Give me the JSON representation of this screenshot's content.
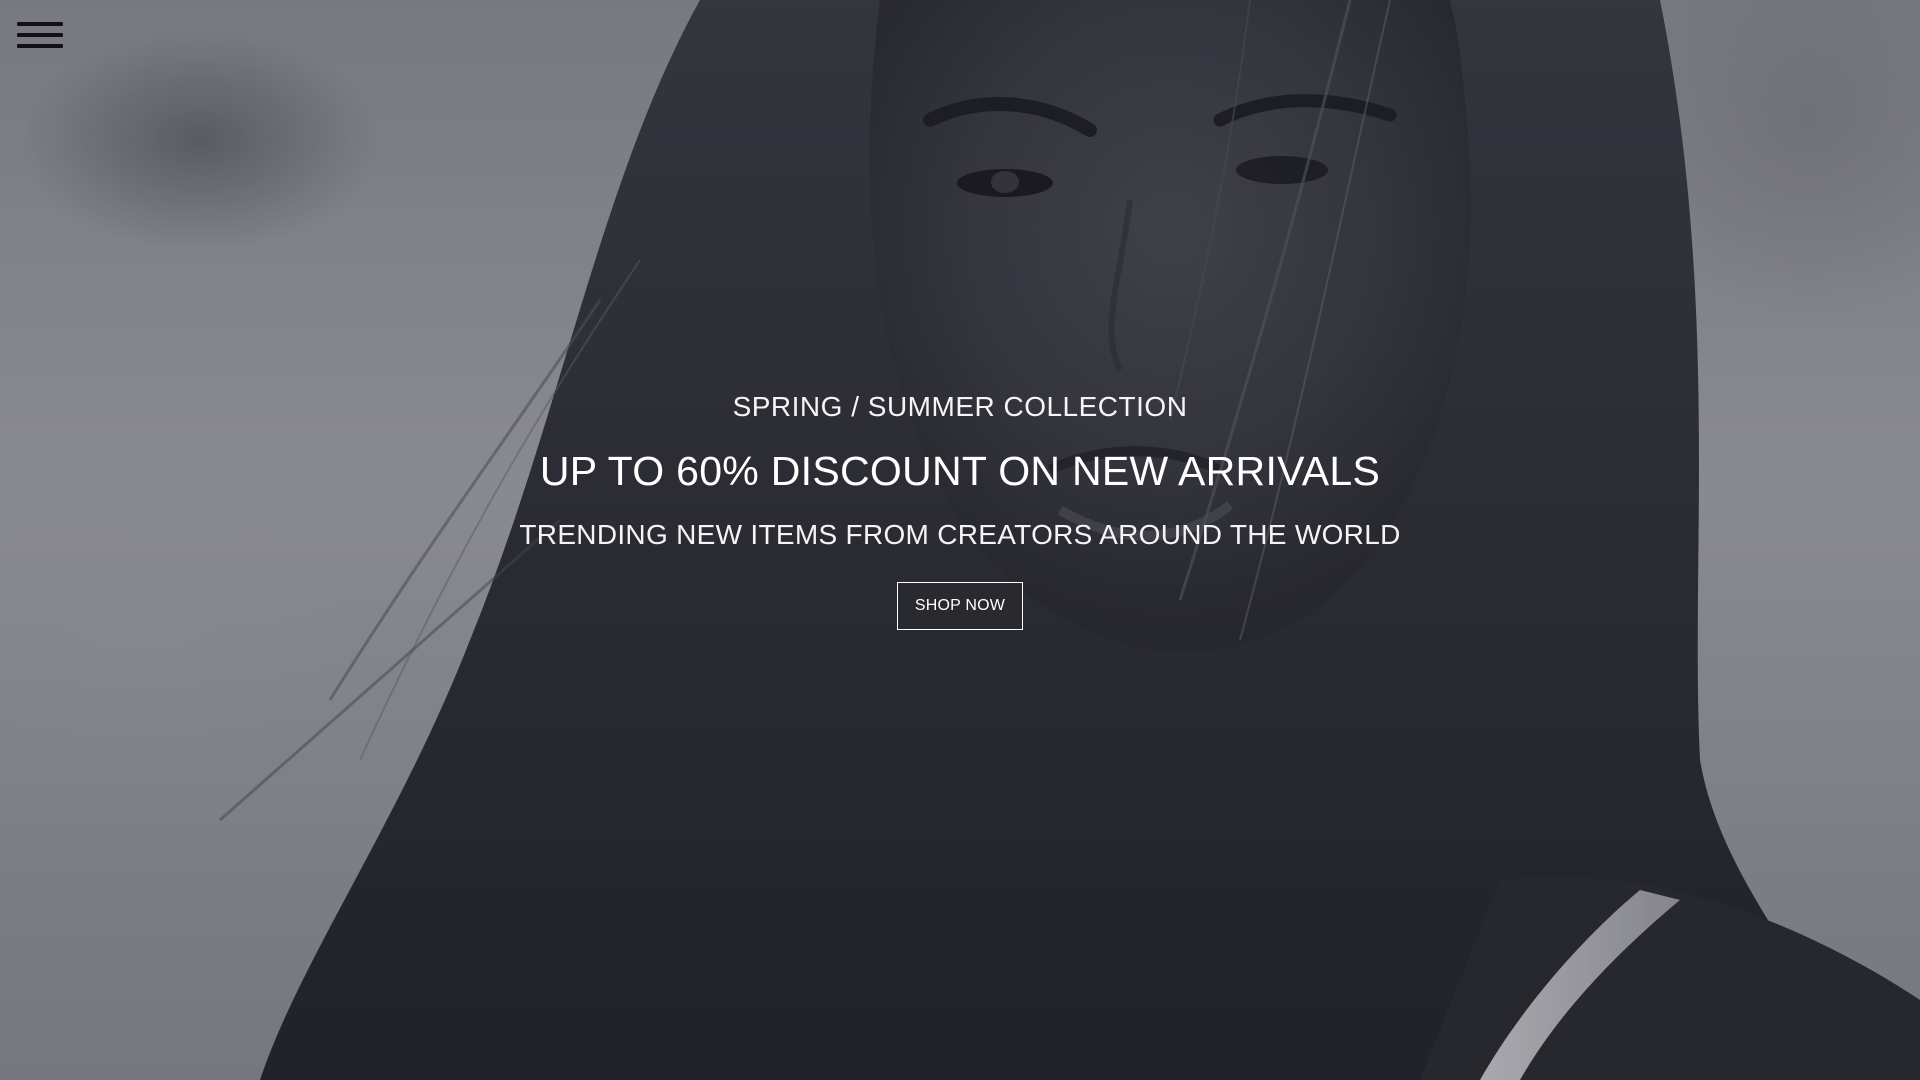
{
  "header": {
    "menu_icon": "hamburger-menu-icon"
  },
  "hero": {
    "kicker": "SPRING / SUMMER COLLECTION",
    "headline": "UP TO 60% DISCOUNT ON NEW ARRIVALS",
    "subline": "TRENDING NEW ITEMS FROM CREATORS AROUND THE WORLD",
    "cta_label": "SHOP NOW",
    "image_description_icon": "model-portrait-photo"
  },
  "colors": {
    "text": "#ffffff",
    "menu_icon": "#111116",
    "background_tone": "#2e2f37"
  }
}
